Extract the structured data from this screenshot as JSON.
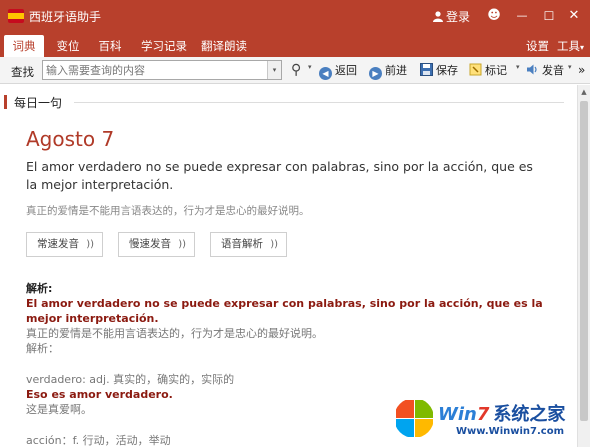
{
  "window": {
    "title": "西班牙语助手",
    "login_label": "登录",
    "smiley_glyph": "☻",
    "min_glyph": "—",
    "max_glyph": "☐",
    "close_glyph": "✕"
  },
  "tabs": [
    {
      "label": "词典",
      "active": true
    },
    {
      "label": "变位",
      "active": false
    },
    {
      "label": "百科",
      "active": false
    },
    {
      "label": "学习记录",
      "active": false
    },
    {
      "label": "翻译朗读",
      "active": false
    }
  ],
  "tab_right": {
    "settings": "设置",
    "tools": "工具",
    "tools_caret": "▾"
  },
  "toolbar": {
    "find_label": "查找",
    "search_placeholder": "输入需要查询的内容",
    "back": "返回",
    "forward": "前进",
    "save": "保存",
    "bookmark": "标记",
    "pronounce": "发音",
    "more": "»",
    "caret": "▾",
    "search_glyph": "⚲"
  },
  "daily": {
    "section_title": "每日一句",
    "date": "Agosto 7",
    "sentence": "El amor verdadero no se puede expresar con palabras, sino por la acción, que es la mejor interpretación.",
    "translation": "真正的爱情是不能用言语表达的，行为才是忠心的最好说明。",
    "buttons": [
      {
        "label": "常速发音",
        "icon": "))"
      },
      {
        "label": "慢速发音",
        "icon": "))"
      },
      {
        "label": "语音解析",
        "icon": "))"
      }
    ]
  },
  "analysis": {
    "heading": "解析:",
    "sentence": "El amor verdadero no se puede expresar con palabras, sino por la acción, que es la mejor interpretación.",
    "translation": "真正的爱情是不能用言语表达的，行为才是忠心的最好说明。",
    "label2": "解析：",
    "word1": "verdadero: adj. 真实的，确实的，实际的",
    "example1": "Eso es amor verdadero.",
    "example1_cn": "这是真爱啊。",
    "word2": "acción：f. 行动，活动，举动"
  },
  "watermark": {
    "brand_win": "Win",
    "brand_7": "7",
    "brand_cn": "系统之家",
    "url": "Www.Winwin7.com"
  },
  "colors": {
    "accent": "#b8402c",
    "red_text": "#8b1a10",
    "date_color": "#b03a28"
  }
}
